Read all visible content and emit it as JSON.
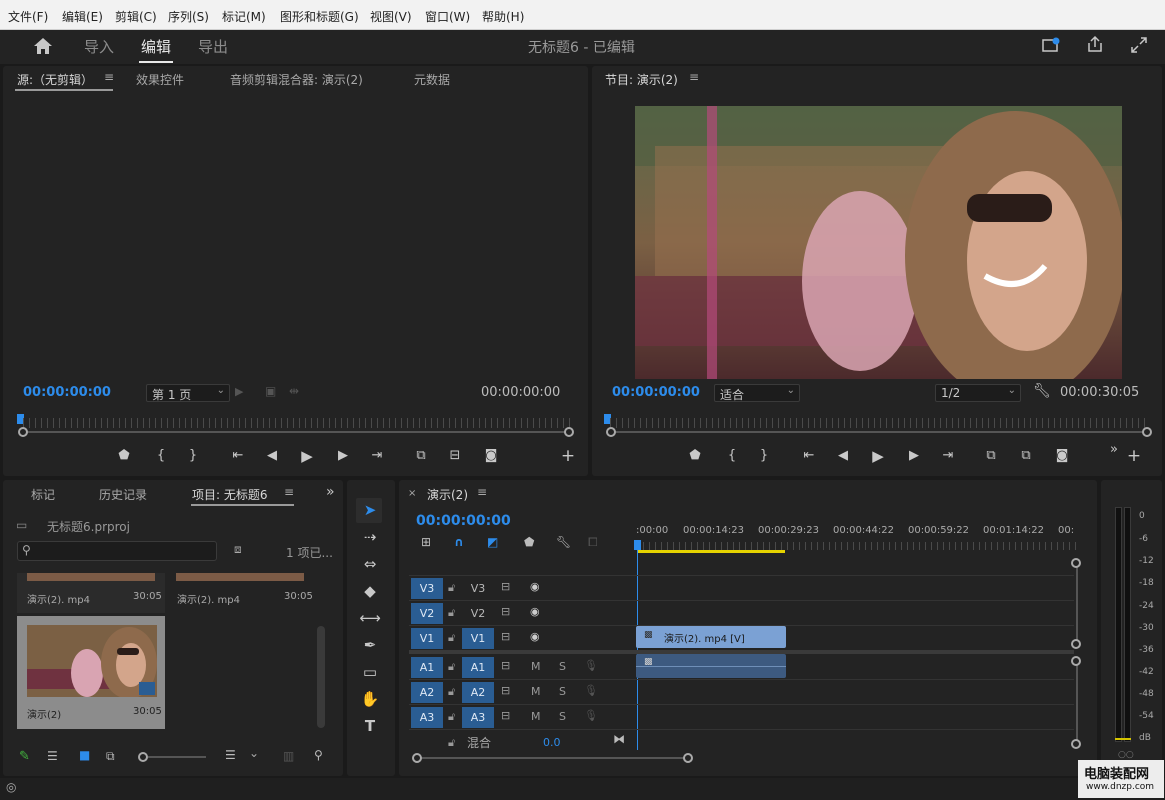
{
  "menu": [
    "文件(F)",
    "编辑(E)",
    "剪辑(C)",
    "序列(S)",
    "标记(M)",
    "图形和标题(G)",
    "视图(V)",
    "窗口(W)",
    "帮助(H)"
  ],
  "workspace": {
    "tabs": [
      "导入",
      "编辑",
      "导出"
    ],
    "active_tab": "编辑",
    "title": "无标题6 - 已编辑"
  },
  "source_panel": {
    "tabs": [
      "源:（无剪辑）",
      "效果控件",
      "音频剪辑混合器: 演示(2)",
      "元数据"
    ],
    "timecode_in": "00:00:00:00",
    "page_select": "第 1 页",
    "timecode_out": "00:00:00:00"
  },
  "program_panel": {
    "title": "节目: 演示(2)",
    "timecode_in": "00:00:00:00",
    "fit_select": "适合",
    "resolution_select": "1/2",
    "timecode_out": "00:00:30:05"
  },
  "project_panel": {
    "tabs": [
      "标记",
      "历史记录",
      "项目: 无标题6"
    ],
    "file_name": "无标题6.prproj",
    "search_placeholder": "",
    "item_count": "1 项已...",
    "items": [
      {
        "name": "演示(2). mp4",
        "duration": "30:05"
      },
      {
        "name": "演示(2). mp4",
        "duration": "30:05"
      },
      {
        "name": "演示(2)",
        "duration": "30:05"
      }
    ]
  },
  "timeline": {
    "tab": "演示(2)",
    "timecode": "00:00:00:00",
    "ruler_ticks": [
      ":00:00",
      "00:00:14:23",
      "00:00:29:23",
      "00:00:44:22",
      "00:00:59:22",
      "00:01:14:22",
      "00:"
    ],
    "video_tracks": [
      {
        "name": "V3",
        "target": "V3"
      },
      {
        "name": "V2",
        "target": "V2"
      },
      {
        "name": "V1",
        "target": "V1"
      }
    ],
    "audio_tracks": [
      {
        "name": "A1",
        "target": "A1",
        "m": "M",
        "s": "S"
      },
      {
        "name": "A2",
        "target": "A2",
        "m": "M",
        "s": "S"
      },
      {
        "name": "A3",
        "target": "A3",
        "m": "M",
        "s": "S"
      }
    ],
    "clip_video": "演示(2). mp4 [V]",
    "mix_label": "混合",
    "mix_value": "0.0"
  },
  "meter": {
    "labels": [
      "0",
      "-6",
      "-12",
      "-18",
      "-24",
      "-30",
      "-36",
      "-42",
      "-48",
      "-54",
      "dB"
    ]
  },
  "watermark": {
    "title": "电脑装配网",
    "url": "www.dnzp.com"
  }
}
